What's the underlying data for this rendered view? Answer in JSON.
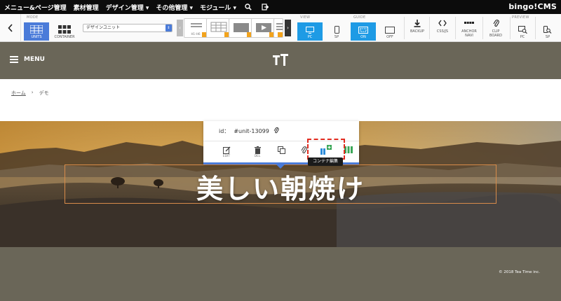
{
  "topbar": {
    "menu_items": [
      "メニュー&ページ管理",
      "素材管理",
      "デザイン管理 ▾",
      "その他管理 ▾",
      "モジュール ▾"
    ],
    "brand": "bingo!CMS"
  },
  "toolbar": {
    "mode_label": "MODE",
    "mode_units": "UNITS",
    "mode_container": "CONTAINER",
    "select_value": "デザインユニット",
    "thumb_hi_he_label": "H1–H6",
    "view_label": "VIEW",
    "view_pc": "PC",
    "view_sp": "SP",
    "guide_label": "GUIDE",
    "guide_on": "ON",
    "guide_off": "OFF",
    "backup": "BACKUP",
    "css_js": "CSS/JS",
    "anchor_navi_1": "ANCHOR",
    "anchor_navi_2": "NAVI",
    "clip_board_1": "CLIP",
    "clip_board_2": "BOARD",
    "preview_label": "PREVIEW",
    "preview_pc": "PC",
    "preview_sp": "SP"
  },
  "header": {
    "menu_label": "MENU"
  },
  "breadcrumb": {
    "home": "ホーム",
    "separator": "›",
    "current": "デモ"
  },
  "hero": {
    "title": "美しい朝焼け"
  },
  "unit_popup": {
    "id_label": "id：",
    "id_value": "#unit-13099",
    "edit": "EDIT",
    "del": "DEL",
    "tooltip": "コンテナ編集"
  },
  "footer": {
    "copyright": "© 2018 Tea Time inc."
  },
  "colors": {
    "header_bg": "#6a6658",
    "accent_blue": "#4a7bd9",
    "active_blue": "#1e9be5",
    "highlight_red": "#e12b1f"
  }
}
